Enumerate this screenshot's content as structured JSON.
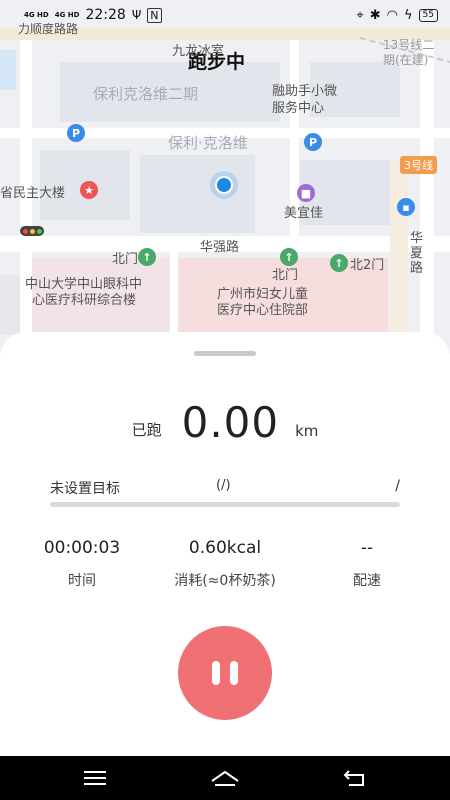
{
  "status_bar": {
    "network_1": "4G HD",
    "network_2": "4G HD",
    "time": "22:28",
    "battery": "55"
  },
  "map": {
    "running_title": "跑步中",
    "labels": {
      "top_left_road": "力顺度路路",
      "jiulong": "九龙冰室",
      "poly_2": "保利克洛维二期",
      "poly": "保利·克洛维",
      "rongzhu": "融助手小微",
      "rongzhu_2": "服务中心",
      "line13": "13号线二",
      "line13_2": "期(在建)",
      "minzhu": "省民主大楼",
      "meiyijia": "美宜佳",
      "huaqiang": "华强路",
      "north_gate_1": "北门",
      "north_gate_2": "北门",
      "north_gate_3": "北2门",
      "zhongshan_1": "中山大学中山眼科中",
      "zhongshan_2": "心医疗科研综合楼",
      "fuyou_1": "广州市妇女儿童",
      "fuyou_2": "医疗中心住院部",
      "huaxia_1": "华",
      "huaxia_2": "夏",
      "huaxia_3": "路",
      "line3": "3号线"
    }
  },
  "run": {
    "distance_prefix": "已跑",
    "distance_value": "0.00",
    "distance_unit": "km",
    "goal_label": "未设置目标",
    "goal_progress": "(/)",
    "goal_slash": "/",
    "goal_fraction": 0,
    "time_value": "00:00:03",
    "time_label": "时间",
    "calorie_value": "0.60kcal",
    "calorie_label": "消耗(≈0杯奶茶)",
    "pace_value": "--",
    "pace_label": "配速"
  },
  "colors": {
    "accent": "#f07173",
    "map_bg": "#eef0f4",
    "road": "#ffffff",
    "hospital": "#f7dede"
  },
  "icons": {
    "pause": "pause-icon",
    "nav_menu": "menu-icon",
    "nav_home": "home-icon",
    "nav_back": "back-icon"
  }
}
